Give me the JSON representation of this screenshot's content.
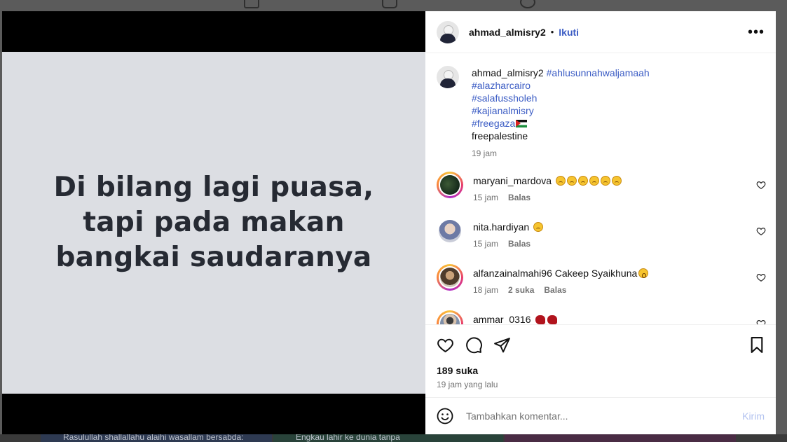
{
  "post": {
    "slide_text": "Di bilang lagi puasa,\ntapi pada makan\nbangkai saudaranya",
    "author": "ahmad_almisry2",
    "separator": "•",
    "follow_label": "Ikuti",
    "more_label": "•••",
    "caption": {
      "user": "ahmad_almisry2",
      "tags": [
        "#ahlusunnahwaljamaah",
        "#alazharcairo",
        "#salafussholeh",
        "#kajianalmisry",
        "#freegaza"
      ],
      "last_line": "freepalestine",
      "time": "19 jam"
    },
    "comments": [
      {
        "user": "maryani_mardova",
        "text": "",
        "time": "15 jam",
        "likes": "",
        "reply": "Balas"
      },
      {
        "user": "nita.hardiyan",
        "text": "",
        "time": "15 jam",
        "likes": "",
        "reply": "Balas"
      },
      {
        "user": "alfanzainalmahi96",
        "text": "Cakeep Syaikhuna",
        "time": "18 jam",
        "likes": "2 suka",
        "reply": "Balas"
      },
      {
        "user": "ammar_0316",
        "text": "",
        "time": "",
        "likes": "",
        "reply": ""
      }
    ],
    "likes_count": "189 suka",
    "time_ago": "19 jam yang lalu",
    "add_comment_placeholder": "Tambahkan komentar...",
    "post_label": "Kirim"
  },
  "background": {
    "bottom_texts": [
      "Rasulullah shallallahu alaihi wasallam bersabda:",
      "Engkau lahir ke dunia tanpa",
      ""
    ]
  },
  "icons": {
    "more": "more-options-icon",
    "like": "heart-icon",
    "comment": "comment-icon",
    "share": "share-icon",
    "save": "bookmark-icon",
    "emoji": "emoji-icon"
  },
  "colors": {
    "link": "#3b5cc4",
    "muted": "#737373",
    "slide_bg": "#dcdee3"
  }
}
